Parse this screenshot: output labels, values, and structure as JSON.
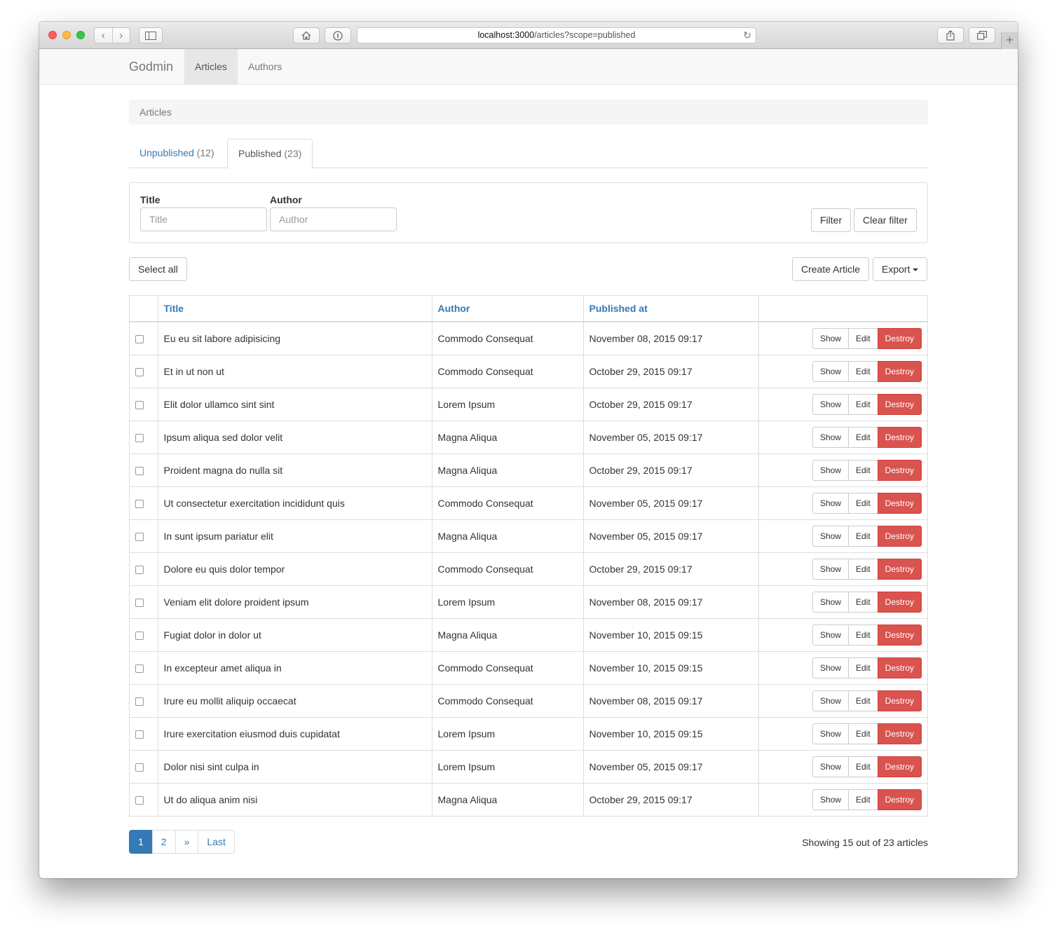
{
  "browser": {
    "url_host": "localhost:3000",
    "url_path": "/articles?scope=published"
  },
  "navbar": {
    "brand": "Godmin",
    "items": [
      {
        "label": "Articles",
        "active": true
      },
      {
        "label": "Authors",
        "active": false
      }
    ]
  },
  "breadcrumb": "Articles",
  "tabs": [
    {
      "label": "Unpublished",
      "count": "(12)",
      "active": false
    },
    {
      "label": "Published",
      "count": "(23)",
      "active": true
    }
  ],
  "filter": {
    "title_label": "Title",
    "title_placeholder": "Title",
    "author_label": "Author",
    "author_placeholder": "Author",
    "filter_button": "Filter",
    "clear_button": "Clear filter"
  },
  "toolbar": {
    "select_all": "Select all",
    "create": "Create Article",
    "export": "Export"
  },
  "table": {
    "columns": [
      "Title",
      "Author",
      "Published at"
    ],
    "action_labels": {
      "show": "Show",
      "edit": "Edit",
      "destroy": "Destroy"
    },
    "rows": [
      {
        "title": "Eu eu sit labore adipisicing",
        "author": "Commodo Consequat",
        "published_at": "November 08, 2015 09:17"
      },
      {
        "title": "Et in ut non ut",
        "author": "Commodo Consequat",
        "published_at": "October 29, 2015 09:17"
      },
      {
        "title": "Elit dolor ullamco sint sint",
        "author": "Lorem Ipsum",
        "published_at": "October 29, 2015 09:17"
      },
      {
        "title": "Ipsum aliqua sed dolor velit",
        "author": "Magna Aliqua",
        "published_at": "November 05, 2015 09:17"
      },
      {
        "title": "Proident magna do nulla sit",
        "author": "Magna Aliqua",
        "published_at": "October 29, 2015 09:17"
      },
      {
        "title": "Ut consectetur exercitation incididunt quis",
        "author": "Commodo Consequat",
        "published_at": "November 05, 2015 09:17"
      },
      {
        "title": "In sunt ipsum pariatur elit",
        "author": "Magna Aliqua",
        "published_at": "November 05, 2015 09:17"
      },
      {
        "title": "Dolore eu quis dolor tempor",
        "author": "Commodo Consequat",
        "published_at": "October 29, 2015 09:17"
      },
      {
        "title": "Veniam elit dolore proident ipsum",
        "author": "Lorem Ipsum",
        "published_at": "November 08, 2015 09:17"
      },
      {
        "title": "Fugiat dolor in dolor ut",
        "author": "Magna Aliqua",
        "published_at": "November 10, 2015 09:15"
      },
      {
        "title": "In excepteur amet aliqua in",
        "author": "Commodo Consequat",
        "published_at": "November 10, 2015 09:15"
      },
      {
        "title": "Irure eu mollit aliquip occaecat",
        "author": "Commodo Consequat",
        "published_at": "November 08, 2015 09:17"
      },
      {
        "title": "Irure exercitation eiusmod duis cupidatat",
        "author": "Lorem Ipsum",
        "published_at": "November 10, 2015 09:15"
      },
      {
        "title": "Dolor nisi sint culpa in",
        "author": "Lorem Ipsum",
        "published_at": "November 05, 2015 09:17"
      },
      {
        "title": "Ut do aliqua anim nisi",
        "author": "Magna Aliqua",
        "published_at": "October 29, 2015 09:17"
      }
    ]
  },
  "pagination": {
    "pages": [
      "1",
      "2"
    ],
    "next": "»",
    "last": "Last",
    "current": "1"
  },
  "summary": "Showing 15 out of 23 articles",
  "colors": {
    "link": "#337ab7",
    "danger": "#d9534f",
    "navbar_bg": "#f8f8f8"
  }
}
